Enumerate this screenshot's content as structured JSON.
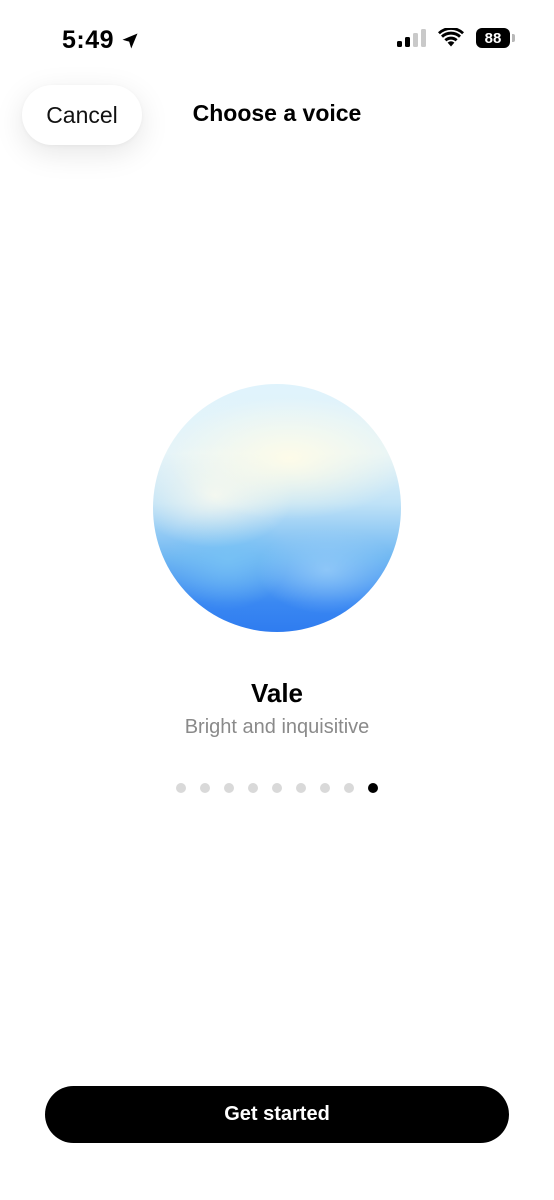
{
  "status_bar": {
    "time": "5:49",
    "location_icon": "location-arrow-icon",
    "signal_icon": "cellular-signal-icon",
    "signal_bars_active": 2,
    "signal_bars_total": 4,
    "wifi_icon": "wifi-icon",
    "battery_level": "88"
  },
  "header": {
    "cancel_label": "Cancel",
    "title": "Choose a voice"
  },
  "voice": {
    "name": "Vale",
    "description": "Bright and inquisitive",
    "orb_colors": [
      "#dff3fc",
      "#fffce8",
      "#6fb7f2",
      "#2f7cf0"
    ]
  },
  "pager": {
    "total": 9,
    "active_index": 8
  },
  "footer": {
    "get_started_label": "Get started"
  }
}
